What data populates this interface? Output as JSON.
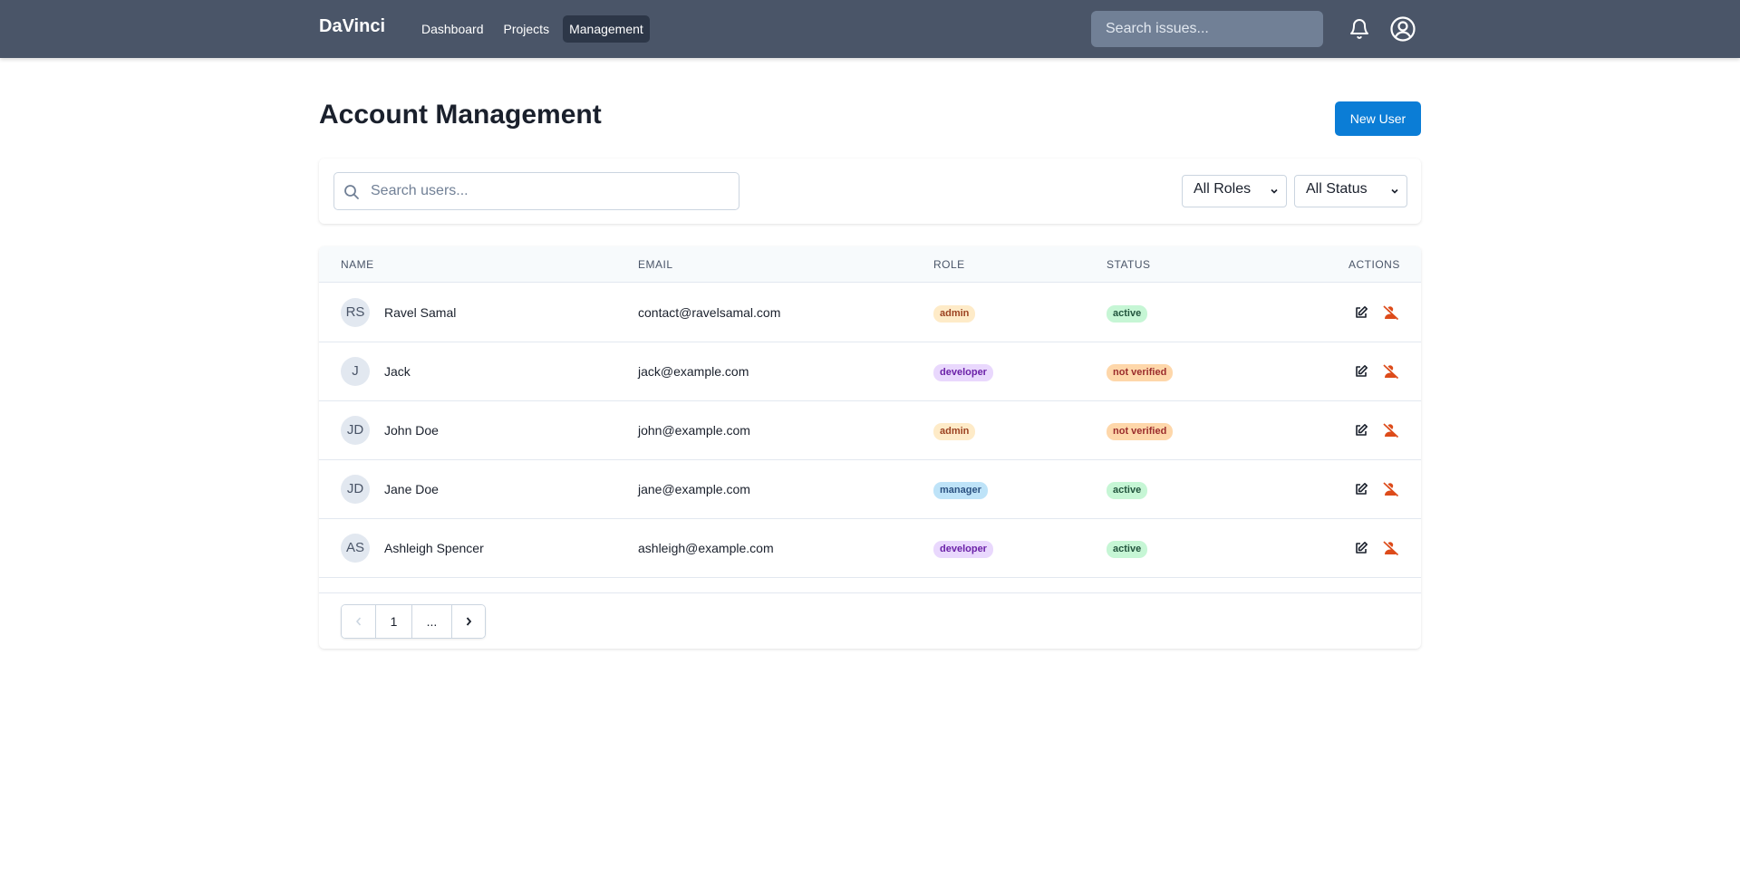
{
  "nav": {
    "brand": "DaVinci",
    "items": [
      {
        "label": "Dashboard",
        "active": false
      },
      {
        "label": "Projects",
        "active": false
      },
      {
        "label": "Management",
        "active": true
      }
    ],
    "search_placeholder": "Search issues...",
    "icons": [
      "bell-icon",
      "user-circle-icon"
    ]
  },
  "page": {
    "title": "Account Management",
    "new_user_label": "New User"
  },
  "filters": {
    "search_placeholder": "Search users...",
    "role_selected": "All Roles",
    "status_selected": "All Status"
  },
  "table": {
    "headers": {
      "name": "NAME",
      "email": "EMAIL",
      "role": "ROLE",
      "status": "STATUS",
      "actions": "ACTIONS"
    },
    "rows": [
      {
        "initials": "RS",
        "name": "Ravel Samal",
        "email": "contact@ravelsamal.com",
        "role": "admin",
        "status": "active"
      },
      {
        "initials": "J",
        "name": "Jack",
        "email": "jack@example.com",
        "role": "developer",
        "status": "not verified"
      },
      {
        "initials": "JD",
        "name": "John Doe",
        "email": "john@example.com",
        "role": "admin",
        "status": "not verified"
      },
      {
        "initials": "JD",
        "name": "Jane Doe",
        "email": "jane@example.com",
        "role": "manager",
        "status": "active"
      },
      {
        "initials": "AS",
        "name": "Ashleigh Spencer",
        "email": "ashleigh@example.com",
        "role": "developer",
        "status": "active"
      }
    ]
  },
  "pagination": {
    "prev": "‹",
    "page": "1",
    "ellipsis": "...",
    "next": "›"
  },
  "colors": {
    "topbar": "#4a5568",
    "accent": "#0b7dd6",
    "remove_icon": "#dd4b1a"
  }
}
